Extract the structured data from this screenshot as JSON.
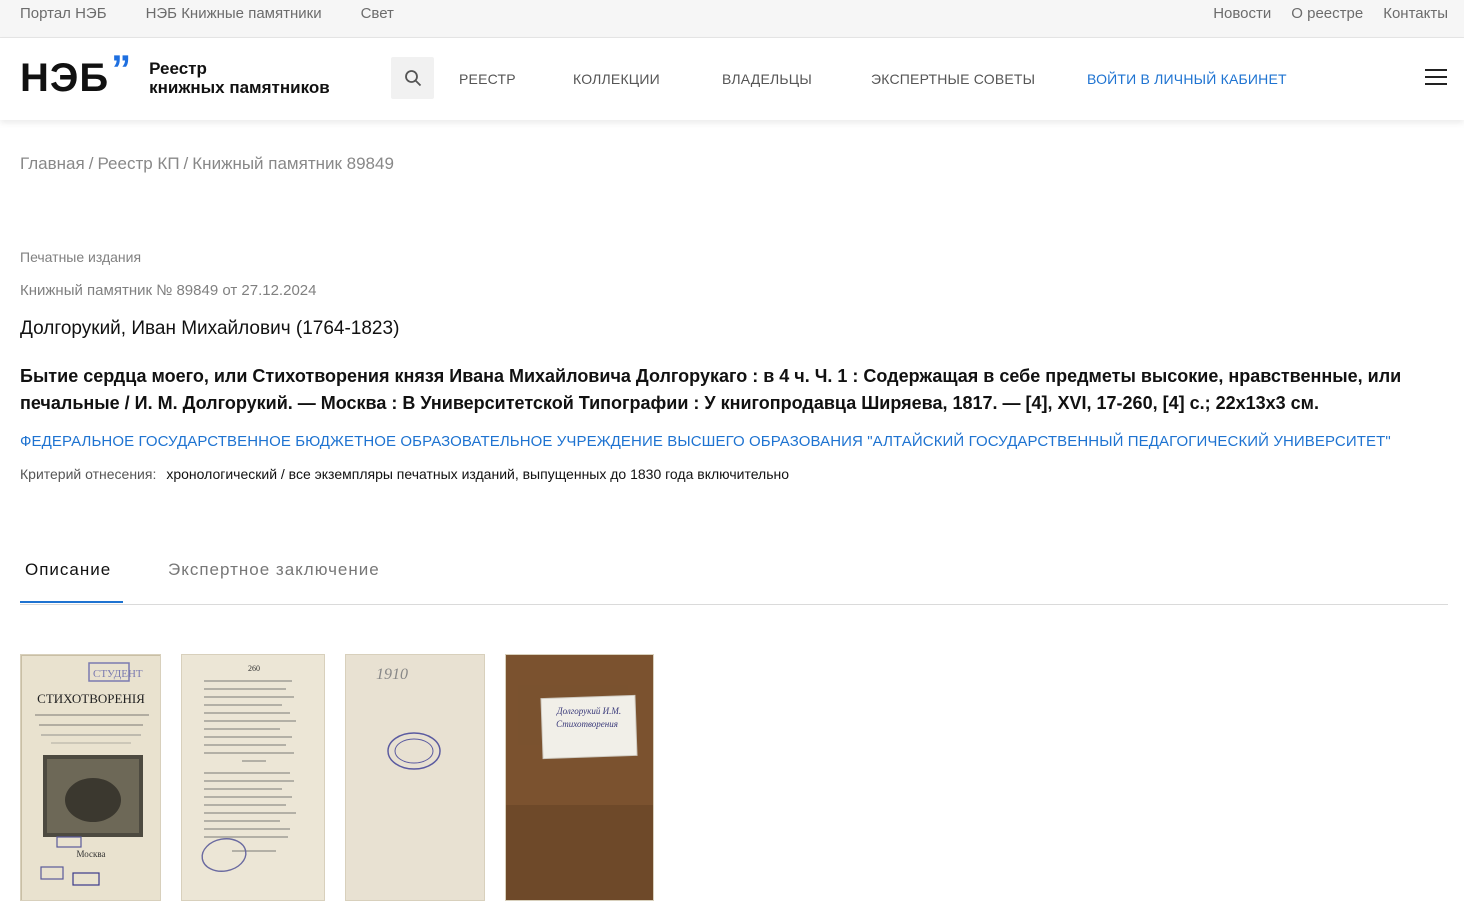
{
  "topbar": {
    "left_links": [
      "Портал НЭБ",
      "НЭБ Книжные памятники",
      "Свет"
    ],
    "right_links": [
      "Новости",
      "О реестре",
      "Контакты"
    ]
  },
  "header": {
    "logo_mark": "НЭБ",
    "logo_quote": "”",
    "logo_line1": "Реестр",
    "logo_line2": "книжных памятников",
    "search_icon": "search-icon",
    "nav": [
      "РЕЕСТР",
      "КОЛЛЕКЦИИ",
      "ВЛАДЕЛЬЦЫ",
      "ЭКСПЕРТНЫЕ СОВЕТЫ"
    ],
    "login": "ВОЙТИ В ЛИЧНЫЙ КАБИНЕТ",
    "menu_icon": "hamburger-menu-icon"
  },
  "breadcrumb": [
    "Главная",
    "Реестр КП",
    "Книжный памятник 89849"
  ],
  "record": {
    "category": "Печатные издания",
    "monument_no": "Книжный памятник № 89849 от 27.12.2024",
    "author": "Долгорукий, Иван Михайлович (1764-1823)",
    "title": "Бытие сердца моего, или Стихотворения князя Ивана Михайловича Долгорукаго : в 4 ч. Ч. 1 : Содержащая в себе предметы высокие, нравственные, или печальные / И. М. Долгорукий. — Москва : В Университетской Типографии : У книгопродавца Ширяева, 1817. — [4], XVI, 17-260, [4] с.; 22х13х3 см.",
    "owner": "ФЕДЕРАЛЬНОЕ ГОСУДАРСТВЕННОЕ БЮДЖЕТНОЕ ОБРАЗОВАТЕЛЬНОЕ УЧРЕЖДЕНИЕ ВЫСШЕГО ОБРАЗОВАНИЯ \"АЛТАЙСКИЙ ГОСУДАРСТВЕННЫЙ ПЕДАГОГИЧЕСКИЙ УНИВЕРСИТЕТ\"",
    "criterion_label": "Критерий отнесения:",
    "criterion_value": "хронологический / все экземпляры печатных изданий, выпущенных до 1830 года включительно"
  },
  "tabs": [
    {
      "label": "Описание",
      "active": true
    },
    {
      "label": "Экспертное заключение",
      "active": false
    }
  ],
  "thumbnails": [
    {
      "name": "title-page",
      "caption_1": "СТИХОТВОРЕНІЯ",
      "caption_2": "Москва"
    },
    {
      "name": "text-page",
      "caption_1": "260"
    },
    {
      "name": "blank-page",
      "caption_1": "1910"
    },
    {
      "name": "cover",
      "caption_1": "Долгорукий И.М.",
      "caption_2": "Стихотворения"
    }
  ],
  "colors": {
    "accent": "#1e73d1",
    "text": "#111111",
    "muted": "#808080"
  }
}
